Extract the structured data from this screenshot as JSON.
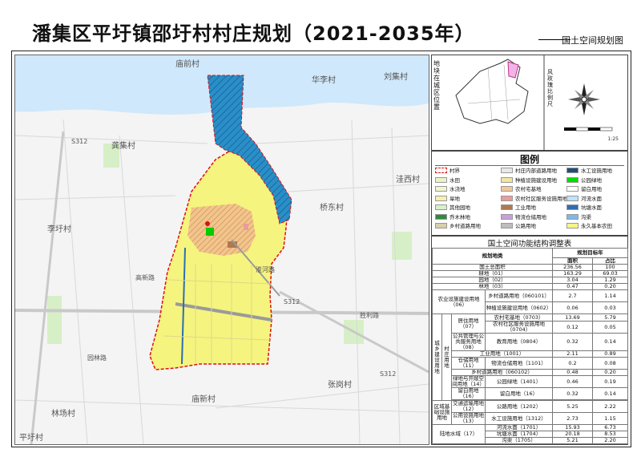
{
  "title": "潘集区平圩镇邵圩村村庄规划（2021-2035年）",
  "subtitle": "国土空间规划图",
  "map": {
    "place_labels": [
      "庙前村",
      "华李村",
      "刘集村",
      "龚集村",
      "李圩村",
      "桥东村",
      "洼西村",
      "林场村",
      "平圩村",
      "庙新村",
      "张岗村"
    ],
    "road_labels": [
      "S312",
      "S312",
      "S312",
      "高新路",
      "淮河路",
      "园林路",
      "胜利路"
    ],
    "colors": {
      "village_boundary": "#e01010",
      "river": "#1f77c6",
      "pond": "#2a6fb0",
      "farmland": "#f5f58a",
      "homestead": "#d9a066",
      "road": "#9a9a9a"
    }
  },
  "location": {
    "label": "地块在城区位置",
    "compass_label": "风玫瑰比例尺",
    "scale_text": "1:25"
  },
  "legend": {
    "title": "图例",
    "items": [
      {
        "label": "村界",
        "color": "#ffffff",
        "border": "#e01010"
      },
      {
        "label": "村庄内部道路用地",
        "color": "#e8e8e8",
        "border": "#999999"
      },
      {
        "label": "水工设施用地",
        "color": "#1f4e79",
        "border": "#999999"
      },
      {
        "label": "水田",
        "color": "#e8f5c8",
        "border": "#999999"
      },
      {
        "label": "种植设施建设用地",
        "color": "#f0e6a0",
        "border": "#999999"
      },
      {
        "label": "公园绿地",
        "color": "#00dd00",
        "border": "#999999"
      },
      {
        "label": "水浇地",
        "color": "#f2f5d0",
        "border": "#999999"
      },
      {
        "label": "农村宅基地",
        "color": "#f2c79a",
        "border": "#999999"
      },
      {
        "label": "留白用地",
        "color": "#ffffff",
        "border": "#999999"
      },
      {
        "label": "旱地",
        "color": "#f7f0b0",
        "border": "#999999"
      },
      {
        "label": "农村社区服务设施用地",
        "color": "#e89c9c",
        "border": "#999999"
      },
      {
        "label": "河流水面",
        "color": "#bfe3f7",
        "border": "#999999"
      },
      {
        "label": "其他园地",
        "color": "#d8f0c8",
        "border": "#999999"
      },
      {
        "label": "工业用地",
        "color": "#b07850",
        "border": "#999999"
      },
      {
        "label": "坑塘水面",
        "color": "#2f6db4",
        "border": "#999999"
      },
      {
        "label": "乔木林地",
        "color": "#2e8b3e",
        "border": "#999999"
      },
      {
        "label": "物流仓储用地",
        "color": "#c9a0dc",
        "border": "#999999"
      },
      {
        "label": "沟渠",
        "color": "#7fb9e6",
        "border": "#999999"
      },
      {
        "label": "乡村道路用地",
        "color": "#d7d0a8",
        "border": "#999999"
      },
      {
        "label": "公路用地",
        "color": "#bdbdbd",
        "border": "#999999"
      },
      {
        "label": "永久基本农田",
        "color": "#f5f58a",
        "border": "#999999"
      }
    ]
  },
  "table": {
    "title": "国土空间功能结构调整表",
    "headers": {
      "category": "规划地类",
      "target": "规划目标年",
      "area": "面积",
      "ratio": "占比"
    },
    "total_row": {
      "label": "国土总面积",
      "area": "236.56",
      "ratio": "100"
    },
    "rows": [
      {
        "c1": "耕地（01）",
        "area": "163.29",
        "ratio": "69.03"
      },
      {
        "c1": "园地（02）",
        "area": "3.04",
        "ratio": "1.29"
      },
      {
        "c1": "林地（03）",
        "area": "0.47",
        "ratio": "0.20"
      }
    ],
    "agri": {
      "label": "农业设施建设用地（06）",
      "sub": [
        {
          "c3": "乡村道路用地（060101）",
          "area": "2.7",
          "ratio": "1.14"
        },
        {
          "c3": "种植设施建设用地（0602）",
          "area": "0.06",
          "ratio": "0.03"
        }
      ]
    },
    "construction": {
      "outer": "城乡建设用地",
      "inner": "村庄用地",
      "rows": [
        {
          "c2": "居住用地（07）",
          "c3": "农村宅基地（0703）",
          "area": "13.69",
          "ratio": "5.79"
        },
        {
          "c2": "",
          "c3": "农村社区服务设施用地（0704）",
          "area": "0.12",
          "ratio": "0.05"
        },
        {
          "c2": "公共管理与公共服务用地（08）",
          "c3": "教育用地（0804）",
          "area": "0.32",
          "ratio": "0.14"
        },
        {
          "c2": "工业用地（1001）",
          "c3": "",
          "area": "2.11",
          "ratio": "0.89"
        },
        {
          "c2": "仓储用地（11）",
          "c3": "物流仓储用地（1101）",
          "area": "0.2",
          "ratio": "0.08"
        },
        {
          "c2": "乡村道路用地（060102）",
          "c3": "",
          "area": "0.48",
          "ratio": "0.20"
        },
        {
          "c2": "绿地与开敞空间用地（14）",
          "c3": "公园绿地（1401）",
          "area": "0.46",
          "ratio": "0.19"
        },
        {
          "c2": "留白用地（16）",
          "c3": "留白用地（16）",
          "area": "0.32",
          "ratio": "0.14"
        }
      ]
    },
    "infra": {
      "label": "区域基础设施用地",
      "rows": [
        {
          "c2": "交通运输用地（12）",
          "c3": "公路用地（1202）",
          "area": "5.25",
          "ratio": "2.22"
        },
        {
          "c2": "公用设施用地（13）",
          "c3": "水工设施用地（1312）",
          "area": "2.73",
          "ratio": "1.15"
        }
      ]
    },
    "water": {
      "label": "陆地水域（17）",
      "rows": [
        {
          "c3": "河流水面（1701）",
          "area": "15.93",
          "ratio": "6.73"
        },
        {
          "c3": "坑塘水面（1704）",
          "area": "20.18",
          "ratio": "8.53"
        },
        {
          "c3": "沟渠（1705）",
          "area": "5.21",
          "ratio": "2.20"
        }
      ]
    }
  }
}
